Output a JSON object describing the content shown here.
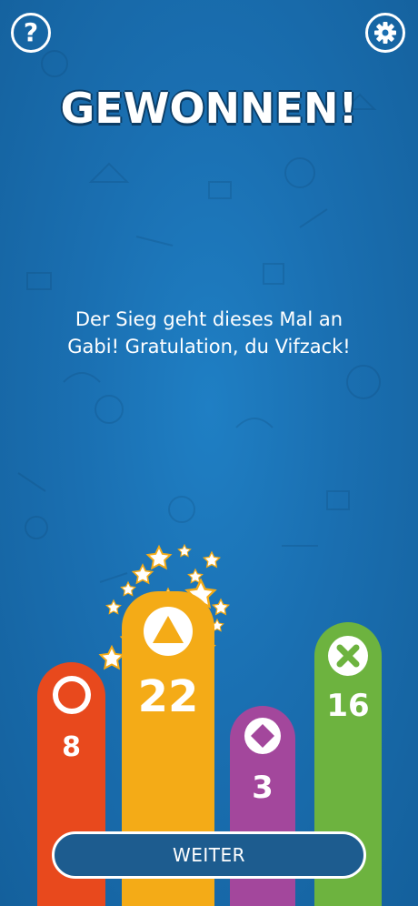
{
  "header": {
    "help_icon": "question-mark-icon",
    "settings_icon": "gear-icon",
    "help_glyph": "?"
  },
  "title": "GEWONNEN!",
  "message": "Der Sieg geht dieses Mal an\nGabi! Gratulation, du Vifzack!",
  "players": [
    {
      "symbol": "circle",
      "score": "8",
      "color": "#e8491d",
      "winner": false
    },
    {
      "symbol": "triangle",
      "score": "22",
      "color": "#f4ab17",
      "winner": true
    },
    {
      "symbol": "diamond",
      "score": "3",
      "color": "#a3479c",
      "winner": false
    },
    {
      "symbol": "cross",
      "score": "16",
      "color": "#6db33f",
      "winner": false
    }
  ],
  "continue_button": {
    "label": "WEITER"
  },
  "colors": {
    "background": "#1a6fb1",
    "button": "#1d5c8f"
  }
}
